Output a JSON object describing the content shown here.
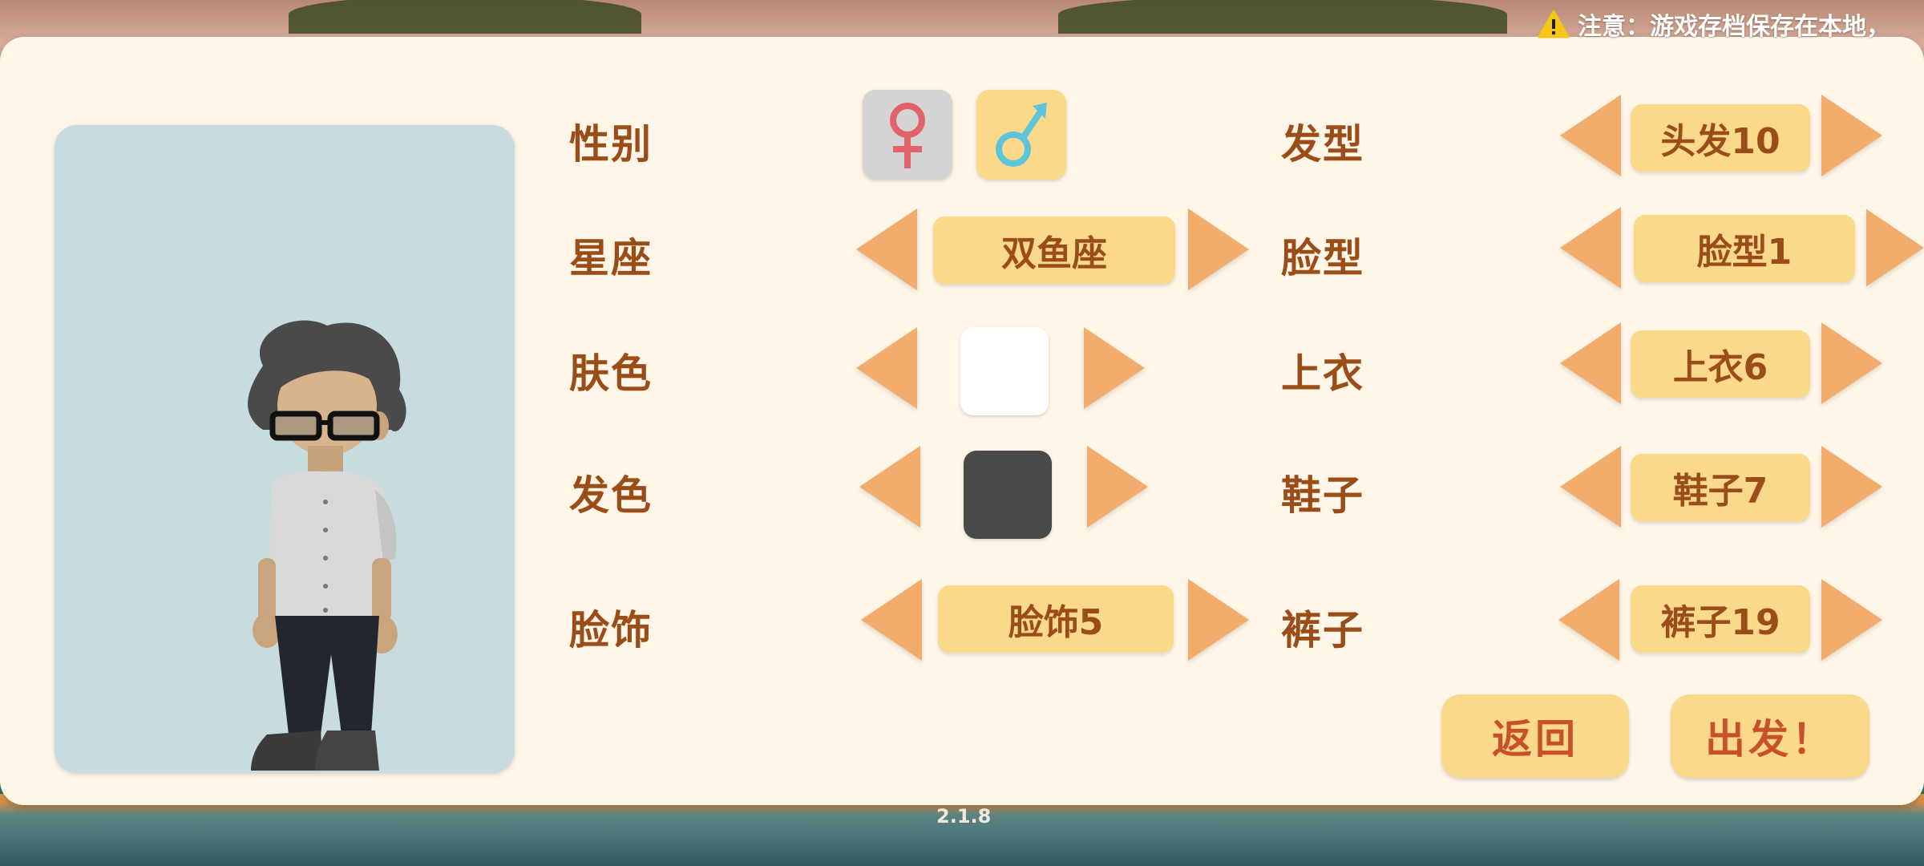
{
  "notice": {
    "icon": "warning-icon",
    "text": "注意：游戏存档保存在本地，"
  },
  "preview": {
    "avatar": "avatar-figure"
  },
  "left_column": {
    "gender": {
      "label": "性别",
      "female_icon": "female-symbol-icon",
      "male_icon": "male-symbol-icon",
      "selected": "male"
    },
    "zodiac": {
      "label": "星座",
      "value": "双鱼座"
    },
    "skin_color": {
      "label": "肤色",
      "value_color": "#ffffff"
    },
    "hair_color": {
      "label": "发色",
      "value_color": "#4a4a4a"
    },
    "face_accessory": {
      "label": "脸饰",
      "value": "脸饰5"
    }
  },
  "right_column": {
    "hairstyle": {
      "label": "发型",
      "value": "头发10"
    },
    "face_shape": {
      "label": "脸型",
      "value": "脸型1"
    },
    "top": {
      "label": "上衣",
      "value": "上衣6"
    },
    "shoes": {
      "label": "鞋子",
      "value": "鞋子7"
    },
    "pants": {
      "label": "裤子",
      "value": "裤子19"
    }
  },
  "buttons": {
    "back": "返回",
    "go": "出发！"
  },
  "version": "2.1.8",
  "colors": {
    "panel": "#fff6e7",
    "accent_arrow": "#f2ad6c",
    "pill": "#fbd98b",
    "label_text": "#9a4d18",
    "female_symbol": "#e2626a",
    "male_symbol": "#5ec4da"
  }
}
